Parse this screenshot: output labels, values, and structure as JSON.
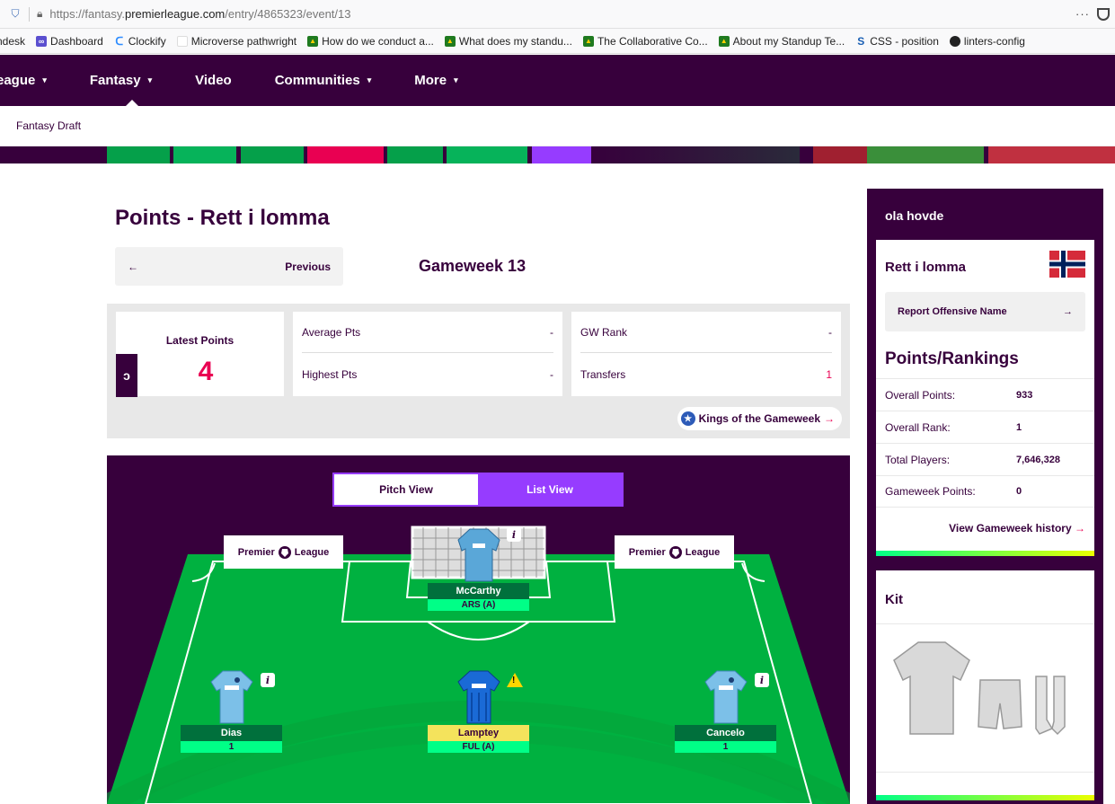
{
  "browser": {
    "url_prefix": "https://fantasy.",
    "url_domain": "premierleague.com",
    "url_path": "/entry/4865323/event/13",
    "menu_label": "···",
    "bookmarks": [
      {
        "label": "ndesk",
        "icon": "none"
      },
      {
        "label": "Dashboard",
        "icon": "dashboard-icon"
      },
      {
        "label": "Clockify",
        "icon": "clockify-icon"
      },
      {
        "label": "Microverse pathwright",
        "icon": "microverse-icon"
      },
      {
        "label": "How do we conduct a...",
        "icon": "doc-icon"
      },
      {
        "label": "What does my standu...",
        "icon": "doc-icon"
      },
      {
        "label": "The Collaborative Co...",
        "icon": "doc-icon"
      },
      {
        "label": "About my Standup Te...",
        "icon": "doc-icon"
      },
      {
        "label": "CSS - position",
        "icon": "css-icon"
      },
      {
        "label": "linters-config",
        "icon": "github-icon"
      }
    ]
  },
  "nav": {
    "items": [
      {
        "label": "eague",
        "has_caret": true
      },
      {
        "label": "Fantasy",
        "has_caret": true
      },
      {
        "label": "Video",
        "has_caret": false
      },
      {
        "label": "Communities",
        "has_caret": true
      },
      {
        "label": "More",
        "has_caret": true
      }
    ],
    "caret": "▾",
    "sub_item": "Fantasy Draft"
  },
  "main": {
    "title": "Points - Rett i lomma",
    "prev_arrow": "←",
    "prev_label": "Previous",
    "gameweek_title": "Gameweek 13",
    "latest_points_label": "Latest Points",
    "latest_points_value": "4",
    "switch_icon": "ↄ",
    "stats": {
      "average_label": "Average Pts",
      "average_value": "-",
      "highest_label": "Highest Pts",
      "highest_value": "-",
      "gw_rank_label": "GW Rank",
      "gw_rank_value": "-",
      "transfers_label": "Transfers",
      "transfers_value": "1"
    },
    "kings_label": "Kings of the Gameweek",
    "kings_arrow": "→"
  },
  "pitch": {
    "toggle": {
      "pitch_view": "Pitch View",
      "list_view": "List View",
      "active": "list"
    },
    "board_left": "Premier League",
    "board_right": "Premier League",
    "board_word1": "Premier",
    "board_word2": "League",
    "players": [
      {
        "name": "McCarthy",
        "fixture": "ARS (A)",
        "role": "goalkeeper",
        "status": "normal",
        "info": "i"
      },
      {
        "name": "Dias",
        "fixture": "1",
        "role": "defender",
        "status": "info",
        "info": "i"
      },
      {
        "name": "Lamptey",
        "fixture": "FUL (A)",
        "role": "defender",
        "status": "warning",
        "info": "!"
      },
      {
        "name": "Cancelo",
        "fixture": "1",
        "role": "defender",
        "status": "info",
        "info": "i"
      }
    ],
    "colors": {
      "grass": "#00b140",
      "grass_stripe": "#05a43b",
      "line": "#ffffff",
      "shirt_city": "#6cabdd",
      "shirt_brighton": "#0057b8"
    }
  },
  "sidebar": {
    "manager": "ola hovde",
    "team": "Rett i lomma",
    "flag": "norway-flag",
    "report_label": "Report Offensive Name",
    "report_arrow": "→",
    "section_title": "Points/Rankings",
    "rankings": [
      {
        "label": "Overall Points:",
        "value": "933"
      },
      {
        "label": "Overall Rank:",
        "value": "1"
      },
      {
        "label": "Total Players:",
        "value": "7,646,328"
      },
      {
        "label": "Gameweek Points:",
        "value": "0"
      }
    ],
    "history_label": "View Gameweek history",
    "history_arrow": "→",
    "kit_title": "Kit"
  },
  "theme": {
    "purple": "#37003c",
    "pink": "#e90052",
    "green": "#00ff87",
    "violet": "#963cff"
  }
}
